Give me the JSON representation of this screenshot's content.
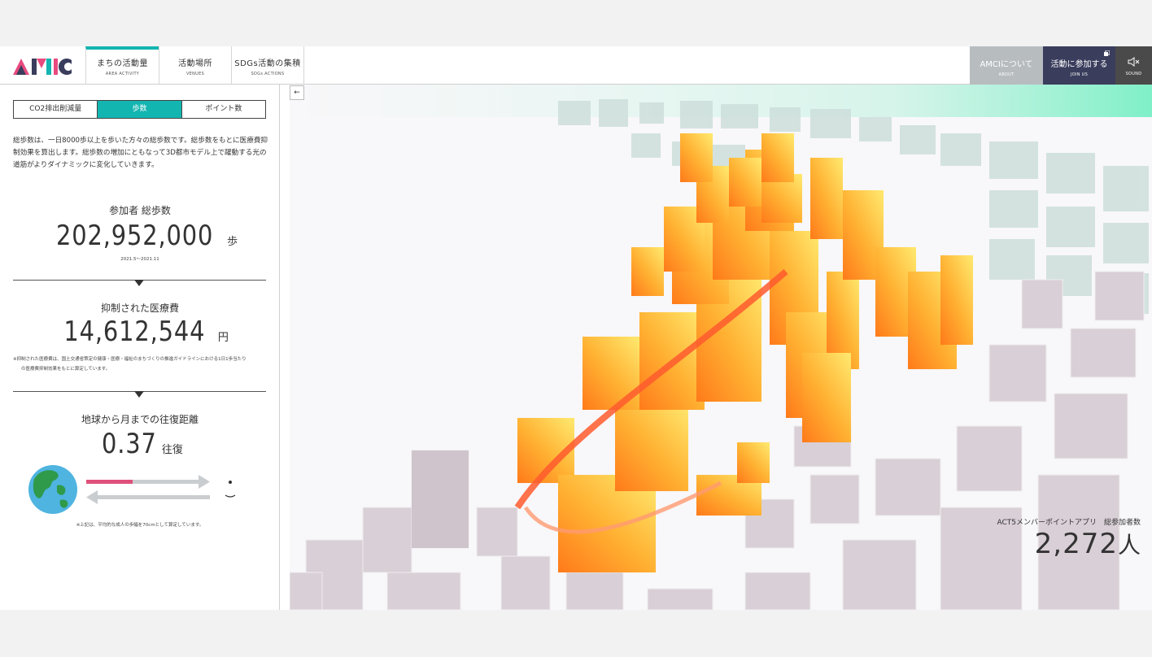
{
  "header": {
    "logo_text": "AMCI",
    "tabs": [
      {
        "label": "まちの活動量",
        "sub": "AREA ACTIVITY"
      },
      {
        "label": "活動場所",
        "sub": "VENUES"
      },
      {
        "label": "SDGs活動の集積",
        "sub": "SDGs ACTIONS"
      }
    ],
    "about": {
      "label": "AMCIについて",
      "sub": "ABOUT"
    },
    "join": {
      "label": "活動に参加する",
      "sub": "JOIN US"
    },
    "sound": {
      "sub": "SOUND"
    }
  },
  "panel": {
    "segments": [
      "CO2排出削減量",
      "歩数",
      "ポイント数"
    ],
    "active_segment": 1,
    "description": "総歩数は、一日8000歩以上を歩いた方々の総歩数です。総歩数をもとに医療費抑制効果を算出します。総歩数の増加にともなって3D都市モデル上で躍動する光の道筋がよりダイナミックに変化していきます。",
    "total_steps": {
      "title": "参加者 総歩数",
      "value": "202,952,000",
      "unit": "歩",
      "period": "2021.5〜2021.11"
    },
    "medical": {
      "title": "抑制された医療費",
      "value": "14,612,544",
      "unit": "円",
      "note_1": "※抑制された医療費は、国土交通省策定の健康・医療・福祉のまちづくりの推進ガイドラインにおける1日1歩当たり",
      "note_2": "の医療費抑制効果をもとに算定しています。"
    },
    "moon": {
      "title": "地球から月までの往復距離",
      "value": "0.37",
      "unit": "往復",
      "progress": 0.37,
      "note": "※上記は、平均的な成人の歩幅を70cmとして算定しています。"
    }
  },
  "map": {
    "collapse_symbol": "←",
    "member_label": "ACT5メンバーポイントアプリ　総参加者数",
    "member_value": "2,272",
    "member_unit": "人"
  },
  "colors": {
    "accent": "#13b5b1",
    "join_bg": "#3a3d5c",
    "about_bg": "#b7bcbf",
    "progress": "#e0507a"
  }
}
